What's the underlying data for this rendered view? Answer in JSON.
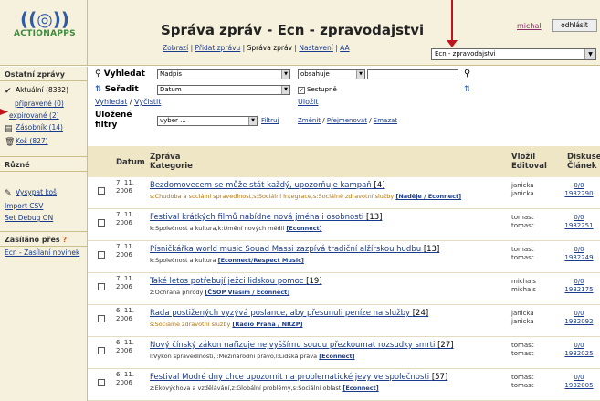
{
  "header": {
    "logo_text": "ACTIONAPPS",
    "title": "Správa zpráv - Ecn - zpravodajstvi",
    "tabs": [
      "Zobrazí",
      "Přidat zprávu",
      "Správa zpráv",
      "Nastavení",
      "AA"
    ],
    "user": "michal",
    "logout_label": "odhlásit",
    "site_select": "Ecn - zpravodajstvi"
  },
  "sidebar": {
    "section1_title": "Ostatní zprávy",
    "items1": [
      {
        "label": "Aktuální (8332)",
        "icon": "checkmark-icon"
      },
      {
        "label": "připravené (0)",
        "icon": ""
      },
      {
        "label": "expirované (2)",
        "icon": ""
      },
      {
        "label": "Zásobník (14)",
        "icon": "folder-icon"
      },
      {
        "label": "Koš (827)",
        "icon": "trash-icon"
      }
    ],
    "section2_title": "Různé",
    "items2": [
      {
        "label": "Vysypat koš",
        "icon": "empty-trash-icon"
      },
      {
        "label": "Import CSV",
        "icon": ""
      },
      {
        "label": "Set Debug ON",
        "icon": ""
      }
    ],
    "section3_title": "Zasíláno přes",
    "items3": [
      {
        "label": "Ecn - Zasílaní novinek"
      }
    ]
  },
  "filters": {
    "search_label": "Vyhledat",
    "search_field": "Nadpis",
    "search_op": "obsahuje",
    "sort_label": "Seřadit",
    "sort_field": "Datum",
    "sort_desc_label": "Sestupně",
    "link_search": "Vyhledat",
    "link_clear": "Vyčistit",
    "link_save": "Uložit",
    "saved_label_1": "Uložené",
    "saved_label_2": "filtry",
    "saved_select": "vyber ...",
    "link_filter": "Filtruj",
    "link_change": "Změnit",
    "link_rename": "Přejmenovat",
    "link_delete": "Smazat"
  },
  "table": {
    "col_date": "Datum",
    "col_msg_1": "Zpráva",
    "col_msg_2": "Kategorie",
    "col_auth_1": "Vložil",
    "col_auth_2": "Editoval",
    "col_disc_1": "Diskuse",
    "col_disc_2": "Článek",
    "rows": [
      {
        "date1": "7. 11.",
        "date2": "2006",
        "headline": "Bezdomovecem se může stát každý, upozorňuje kampaň",
        "count": "[4]",
        "cats": "s:Chudoba a sociální spravedlnost,s:Sociální integrace,s:Sociálně zdravotní služby ",
        "src": "[Naděje / Econnect]",
        "orange": true,
        "author": "janicka",
        "editor": "janicka",
        "disc": "0/0",
        "article": "1932290"
      },
      {
        "date1": "7. 11.",
        "date2": "2006",
        "headline": "Festival krátkých filmů nabídne nová jména i osobnosti",
        "count": "[13]",
        "cats": "k:Společnost a kultura,k:Umění nových médií ",
        "src": "[Econnect]",
        "orange": false,
        "author": "tomast",
        "editor": "tomast",
        "disc": "0/0",
        "article": "1932251"
      },
      {
        "date1": "7. 11.",
        "date2": "2006",
        "headline": "Písničkářka world music Souad Massi zazpívá tradiční alžírskou hudbu",
        "count": "[13]",
        "cats": "k:Společnost a kultura ",
        "src": "[Econnect/Respect Music]",
        "orange": false,
        "author": "tomast",
        "editor": "tomast",
        "disc": "0/0",
        "article": "1932249"
      },
      {
        "date1": "7. 11.",
        "date2": "2006",
        "headline": "Také letos potřebují ježci lidskou pomoc",
        "count": "[19]",
        "cats": "z:Ochrana přírody ",
        "src": "[ČSOP Vlašim / Econnect]",
        "orange": false,
        "author": "michals",
        "editor": "michals",
        "disc": "0/0",
        "article": "1932175"
      },
      {
        "date1": "6. 11.",
        "date2": "2006",
        "headline": "Rada postižených vyzývá poslance, aby přesunuli peníze na služby",
        "count": "[24]",
        "cats": "s:Sociálně zdravotní služby ",
        "src": "[Radio Praha / NRZP]",
        "orange": true,
        "author": "janicka",
        "editor": "janicka",
        "disc": "0/0",
        "article": "1932092"
      },
      {
        "date1": "6. 11.",
        "date2": "2006",
        "headline": "Nový čínský zákon nařizuje nejvyššímu soudu přezkoumat rozsudky smrti",
        "count": "[27]",
        "cats": "l:Výkon spravedlnosti,l:Mezinárodní právo,l:Lidská práva ",
        "src": "[Econnect]",
        "orange": false,
        "author": "tomast",
        "editor": "tomast",
        "disc": "0/0",
        "article": "1932025"
      },
      {
        "date1": "6. 11.",
        "date2": "2006",
        "headline": "Festival Modré dny chce upozornit na problematické jevy ve společnosti",
        "count": "[57]",
        "cats": "z:Ekovýchova a vzdělávání,z:Globální problémy,s:Sociální oblast ",
        "src": "[Econnect]",
        "orange": false,
        "author": "tomast",
        "editor": "tomast",
        "disc": "0/0",
        "article": "1932005"
      }
    ]
  },
  "colors": {
    "accent_red": "#c0141c",
    "panel": "#f6f1dc",
    "link": "#1a3a8c"
  }
}
